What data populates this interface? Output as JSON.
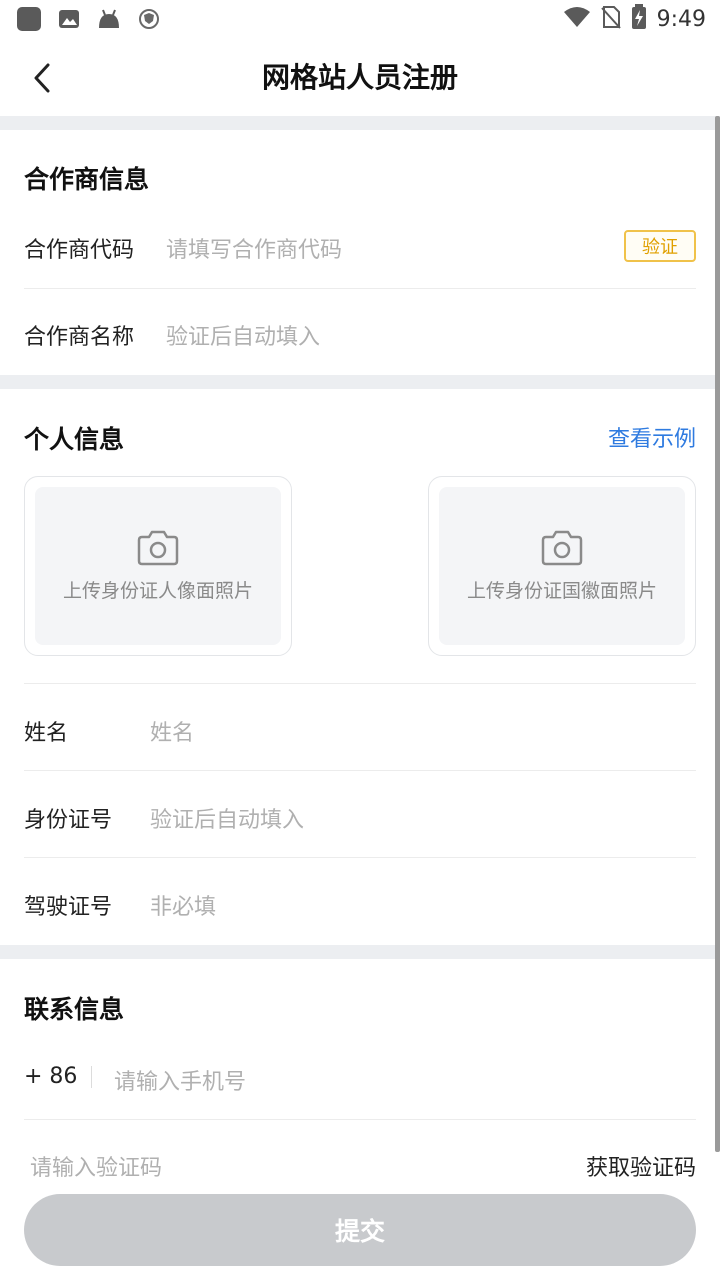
{
  "status_bar": {
    "time": "9:49",
    "left_icons": [
      "app-icon",
      "gallery-icon",
      "android-icon",
      "vpn-shield-icon"
    ],
    "right_icons": [
      "wifi-icon",
      "no-sim-icon",
      "battery-charging-icon"
    ]
  },
  "nav": {
    "title": "网格站人员注册",
    "back_icon": "chevron-left-icon"
  },
  "partner_section": {
    "title": "合作商信息",
    "code_label": "合作商代码",
    "code_placeholder": "请填写合作商代码",
    "verify_label": "验证",
    "name_label": "合作商名称",
    "name_placeholder": "验证后自动填入"
  },
  "personal_section": {
    "title": "个人信息",
    "example_link": "查看示例",
    "upload_front": "上传身份证人像面照片",
    "upload_back": "上传身份证国徽面照片",
    "name_label": "姓名",
    "name_placeholder": "姓名",
    "id_label": "身份证号",
    "id_placeholder": "验证后自动填入",
    "license_label": "驾驶证号",
    "license_placeholder": "非必填"
  },
  "contact_section": {
    "title": "联系信息",
    "country_code": "+ 86",
    "phone_placeholder": "请输入手机号",
    "code_placeholder": "请输入验证码",
    "get_code": "获取验证码"
  },
  "submit_label": "提交",
  "colors": {
    "accent_link": "#2f7be0",
    "verify_border": "#f0c24a",
    "verify_text": "#e0a000",
    "submit_disabled": "#c8cacd",
    "section_gap": "#eceef1"
  }
}
